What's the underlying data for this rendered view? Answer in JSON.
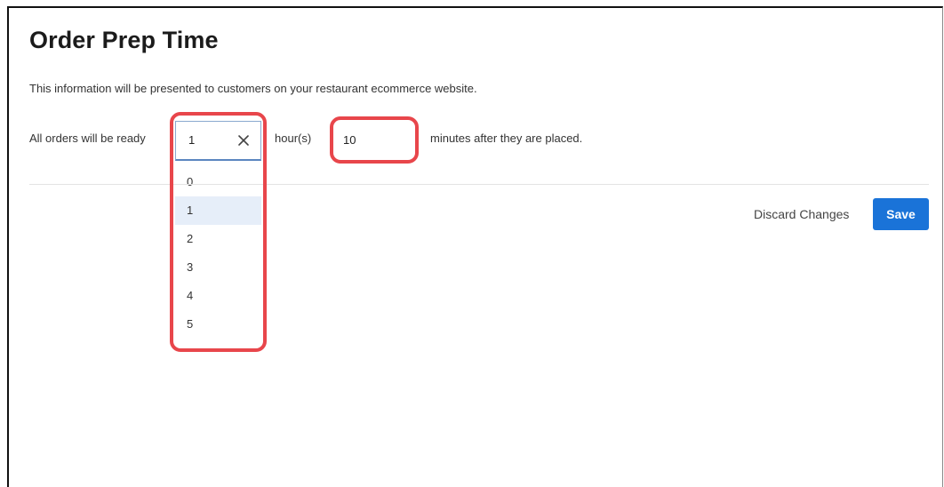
{
  "page": {
    "title": "Order Prep Time",
    "description": "This information will be presented to customers on your restaurant ecommerce website."
  },
  "form": {
    "ready_label": "All orders will be ready",
    "hours": {
      "value": "1",
      "unit_label": "hour(s)",
      "options": [
        "0",
        "1",
        "2",
        "3",
        "4",
        "5"
      ],
      "selected_index": 1
    },
    "minutes": {
      "value": "10"
    },
    "after_label": "minutes after they are placed."
  },
  "actions": {
    "discard_label": "Discard Changes",
    "save_label": "Save"
  },
  "colors": {
    "accent": "#1a73d8",
    "highlight": "#e8464b",
    "selected_option_bg": "#e6eef9"
  },
  "icons": {
    "clear": "close-icon"
  }
}
